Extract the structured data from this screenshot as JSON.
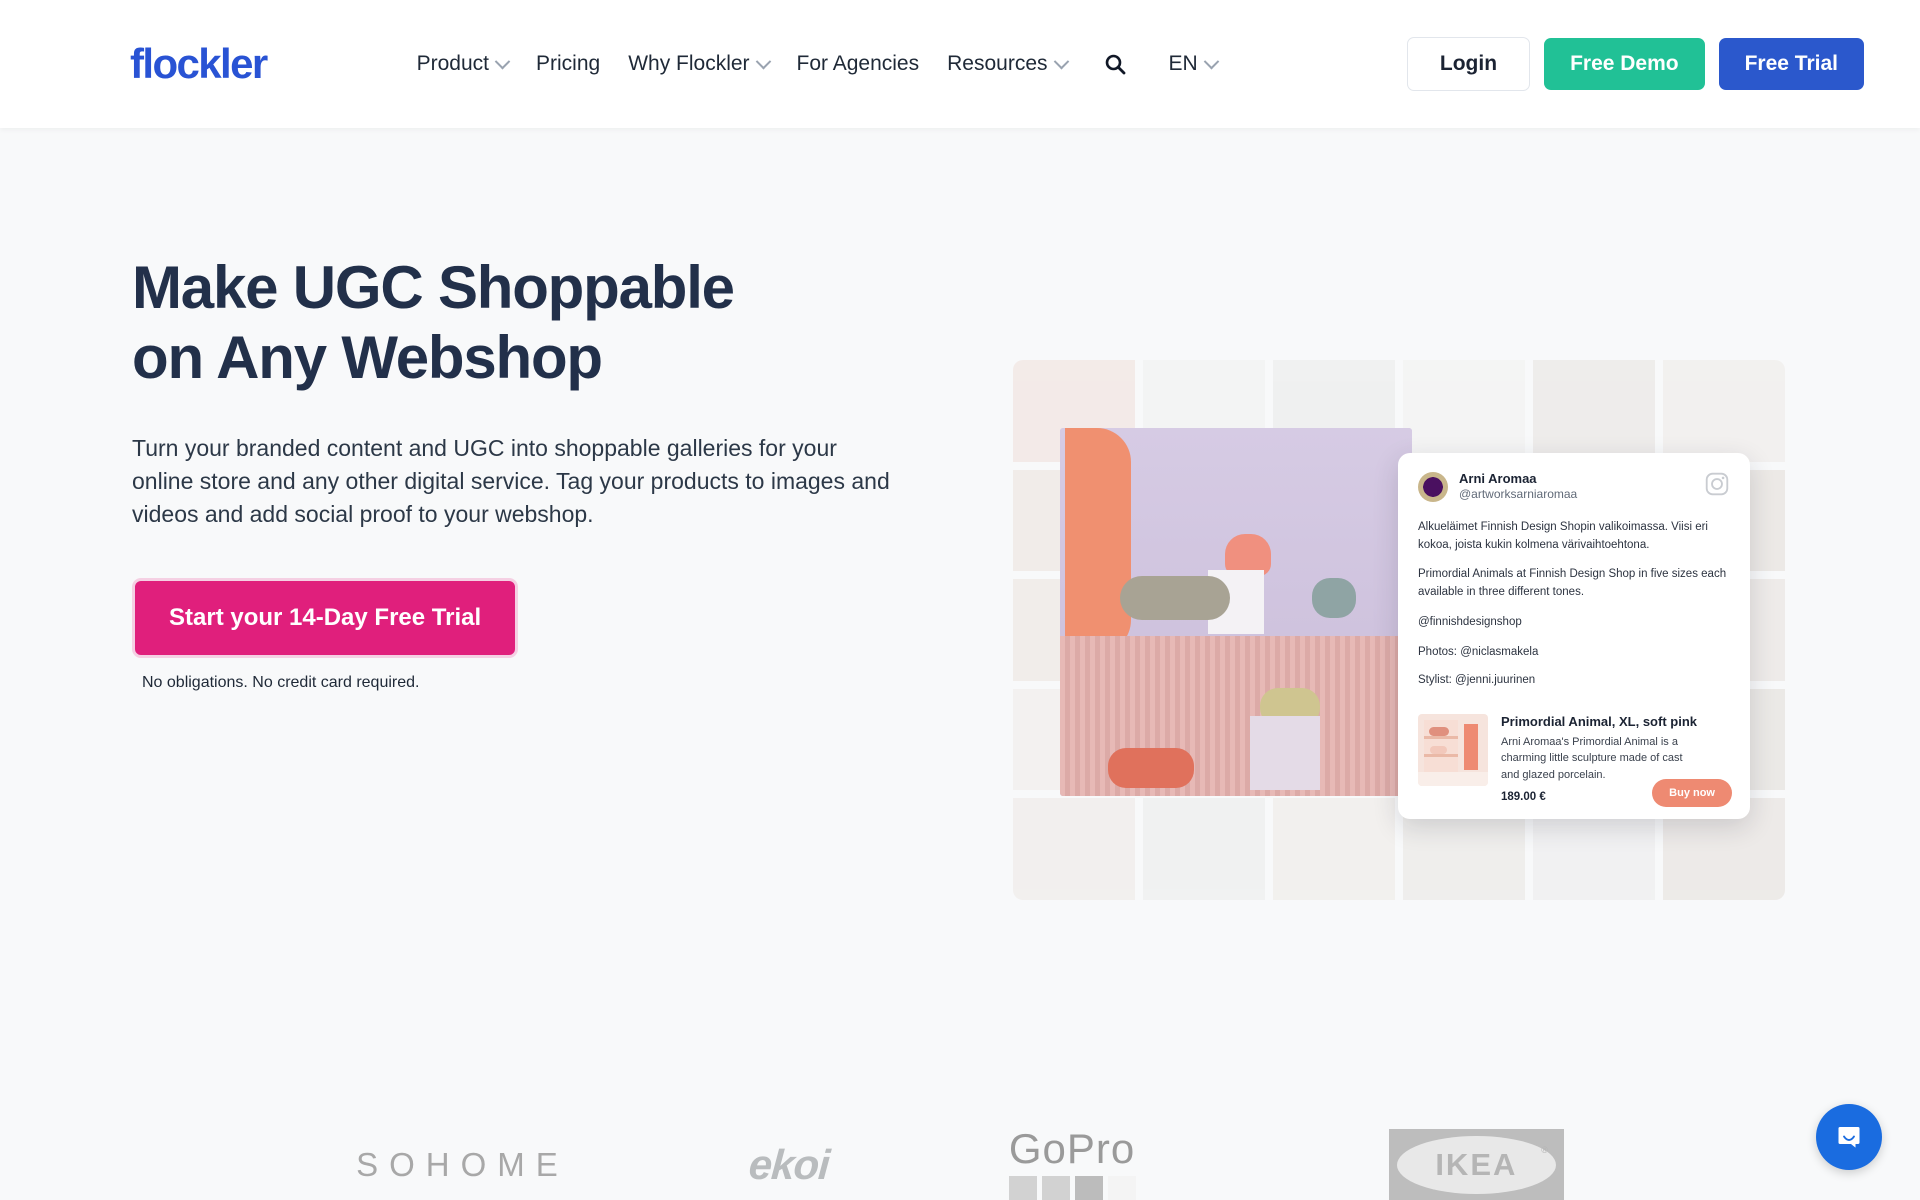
{
  "header": {
    "logo_text": "flockler",
    "nav": [
      {
        "label": "Product",
        "has_dropdown": true
      },
      {
        "label": "Pricing",
        "has_dropdown": false
      },
      {
        "label": "Why Flockler",
        "has_dropdown": true
      },
      {
        "label": "For Agencies",
        "has_dropdown": false
      },
      {
        "label": "Resources",
        "has_dropdown": true
      }
    ],
    "search_icon": "search-icon",
    "language": "EN",
    "login_label": "Login",
    "free_demo_label": "Free Demo",
    "free_trial_label": "Free Trial",
    "colors": {
      "logo": "#2953d4",
      "free_demo": "#21c196",
      "free_trial": "#2b58cc"
    }
  },
  "hero": {
    "headline_line1": "Make UGC Shoppable",
    "headline_line2": "on Any Webshop",
    "subcopy": "Turn your branded content and UGC into shoppable galleries for your online store and any other digital service. Tag your products to images and videos and add social proof to your webshop.",
    "cta_label": "Start your 14-Day Free Trial",
    "cta_note": "No obligations. No credit card required.",
    "cta_color": "#e01f7c",
    "headline_color": "#22304a"
  },
  "post_card": {
    "author_name": "Arni Aromaa",
    "author_handle": "@artworksarniaromaa",
    "network_icon": "instagram-icon",
    "body_1": "Alkueläimet Finnish Design Shopin valikoimassa. Viisi eri kokoa, joista kukin kolmena värivaihtoehtona.",
    "body_2": "Primordial Animals at Finnish Design Shop in five sizes each available in three different tones.",
    "body_3": "@finnishdesignshop",
    "body_4_photos": "Photos: @niclasmakela",
    "body_4_stylist": "Stylist: @jenni.juurinen",
    "product": {
      "title": "Primordial Animal, XL, soft pink",
      "description": "Arni Aromaa's Primordial Animal is a charming little sculpture made of cast and glazed porcelain.",
      "price": "189.00 €",
      "buy_label": "Buy now",
      "buy_color": "#ee8a72"
    }
  },
  "logo_strip": {
    "brands": [
      {
        "name": "SOHOME",
        "label": "SOHOME"
      },
      {
        "name": "EKOI",
        "label": "ekoi"
      },
      {
        "name": "GoPro",
        "label": "GoPro"
      },
      {
        "name": "IKEA",
        "label": "IKEA",
        "registered": "®"
      }
    ]
  },
  "chat_widget": {
    "icon": "chat-bubble-icon",
    "color": "#1a6ce0"
  }
}
